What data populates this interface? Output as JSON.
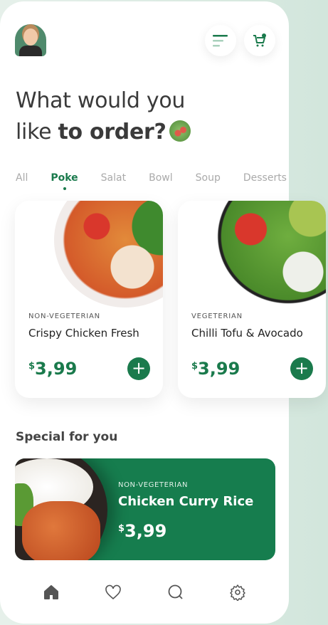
{
  "header": {
    "title_line1": "What would you",
    "title_line2_regular": "like ",
    "title_line2_bold": "to order?"
  },
  "tabs": [
    {
      "label": "All"
    },
    {
      "label": "Poke",
      "active": true
    },
    {
      "label": "Salat"
    },
    {
      "label": "Bowl"
    },
    {
      "label": "Soup"
    },
    {
      "label": "Desserts"
    }
  ],
  "cards": [
    {
      "category": "NON-VEGETERIAN",
      "name": "Crispy Chicken Fresh",
      "currency": "$",
      "price": "3,99"
    },
    {
      "category": "VEGETERIAN",
      "name": "Chilli Tofu & Avocado",
      "currency": "$",
      "price": "3,99"
    }
  ],
  "special": {
    "title": "Special for you",
    "category": "NON-VEGETERIAN",
    "name": "Chicken Curry Rice",
    "currency": "$",
    "price": "3,99"
  },
  "colors": {
    "accent": "#1a7a4c",
    "special_bg": "#167d4e"
  },
  "icons": [
    "menu-icon",
    "cart-icon",
    "home-icon",
    "heart-icon",
    "search-icon",
    "gear-icon"
  ]
}
